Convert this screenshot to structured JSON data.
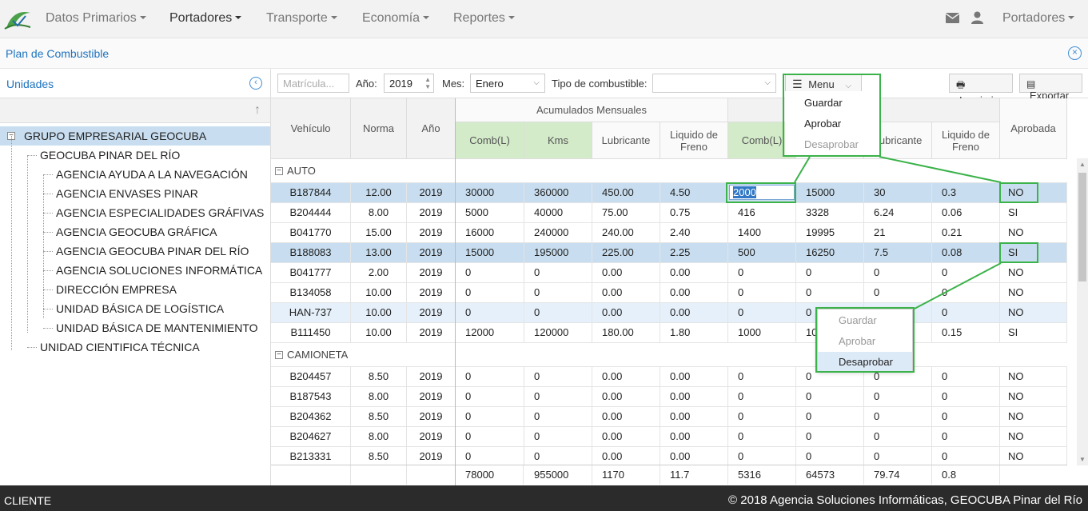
{
  "nav": {
    "items": [
      "Datos Primarios",
      "Portadores",
      "Transporte",
      "Economía",
      "Reportes"
    ],
    "right_label": "Portadores",
    "icons": [
      "envelope-icon",
      "user-icon"
    ]
  },
  "titlebar": {
    "title": "Plan de Combustible"
  },
  "left": {
    "header": "Unidades",
    "tree": [
      {
        "label": "GRUPO EMPRESARIAL GEOCUBA",
        "level": 0,
        "selected": true
      },
      {
        "label": "GEOCUBA PINAR DEL RÍO",
        "level": 1
      },
      {
        "label": "AGENCIA AYUDA A LA NAVEGACIÓN",
        "level": 2
      },
      {
        "label": "AGENCIA ENVASES PINAR",
        "level": 2
      },
      {
        "label": "AGENCIA ESPECIALIDADES GRÁFIVAS",
        "level": 2
      },
      {
        "label": "AGENCIA GEOCUBA GRÁFICA",
        "level": 2
      },
      {
        "label": "AGENCIA GEOCUBA PINAR DEL RÍO",
        "level": 2
      },
      {
        "label": "AGENCIA SOLUCIONES INFORMÁTICA",
        "level": 2
      },
      {
        "label": "DIRECCIÓN EMPRESA",
        "level": 2
      },
      {
        "label": "UNIDAD BÁSICA DE LOGÍSTICA",
        "level": 2
      },
      {
        "label": "UNIDAD BÁSICA DE MANTENIMIENTO",
        "level": 2
      },
      {
        "label": "UNIDAD CIENTIFICA TÉCNICA",
        "level": 1
      }
    ]
  },
  "toolbar": {
    "matricula_placeholder": "Matrícula...",
    "anio_label": "Año:",
    "anio_value": "2019",
    "mes_label": "Mes:",
    "mes_value": "Enero",
    "tipo_label": "Tipo de combustible:",
    "tipo_value": "",
    "menu_label": "Menu",
    "imprimir_label": "Imprimir",
    "exportar_label": "Exportar"
  },
  "grid": {
    "headers": {
      "vehiculo": "Vehículo",
      "norma": "Norma",
      "anio": "Año",
      "acumulados": "Acumulados Mensuales",
      "comb": "Comb(L)",
      "kms": "Kms",
      "lubricante": "Lubricante",
      "liquido": "Liquido de Freno",
      "comb2": "Comb(L)",
      "lubricante2": "Lubricante",
      "liquido2": "Liquido de Freno",
      "aprobada": "Aprobada"
    },
    "groups": [
      {
        "name": "AUTO",
        "rows": [
          [
            "B187844",
            "12.00",
            "2019",
            "30000",
            "360000",
            "450.00",
            "4.50",
            "2000",
            "15000",
            "30",
            "0.3",
            "NO"
          ],
          [
            "B204444",
            "8.00",
            "2019",
            "5000",
            "40000",
            "75.00",
            "0.75",
            "416",
            "3328",
            "6.24",
            "0.06",
            "SI"
          ],
          [
            "B041770",
            "15.00",
            "2019",
            "16000",
            "240000",
            "240.00",
            "2.40",
            "1400",
            "19995",
            "21",
            "0.21",
            "NO"
          ],
          [
            "B188083",
            "13.00",
            "2019",
            "15000",
            "195000",
            "225.00",
            "2.25",
            "500",
            "16250",
            "7.5",
            "0.08",
            "SI"
          ],
          [
            "B041777",
            "2.00",
            "2019",
            "0",
            "0",
            "0.00",
            "0.00",
            "0",
            "0",
            "0",
            "0",
            "NO"
          ],
          [
            "B134058",
            "10.00",
            "2019",
            "0",
            "0",
            "0.00",
            "0.00",
            "0",
            "0",
            "0",
            "0",
            "NO"
          ],
          [
            "HAN-737",
            "10.00",
            "2019",
            "0",
            "0",
            "0.00",
            "0.00",
            "0",
            "0",
            "0",
            "0",
            "NO"
          ],
          [
            "B111450",
            "10.00",
            "2019",
            "12000",
            "120000",
            "180.00",
            "1.80",
            "1000",
            "10",
            "",
            "0.15",
            "SI"
          ]
        ]
      },
      {
        "name": "CAMIONETA",
        "rows": [
          [
            "B204457",
            "8.50",
            "2019",
            "0",
            "0",
            "0.00",
            "0.00",
            "0",
            "0",
            "0",
            "0",
            "NO"
          ],
          [
            "B187543",
            "8.00",
            "2019",
            "0",
            "0",
            "0.00",
            "0.00",
            "0",
            "0",
            "0",
            "0",
            "NO"
          ],
          [
            "B204362",
            "8.50",
            "2019",
            "0",
            "0",
            "0.00",
            "0.00",
            "0",
            "0",
            "0",
            "0",
            "NO"
          ],
          [
            "B204627",
            "8.00",
            "2019",
            "0",
            "0",
            "0.00",
            "0.00",
            "0",
            "0",
            "0",
            "0",
            "NO"
          ],
          [
            "B213331",
            "8.50",
            "2019",
            "0",
            "0",
            "0.00",
            "0.00",
            "0",
            "0",
            "0",
            "0",
            "NO"
          ]
        ]
      }
    ],
    "totals": [
      "78000",
      "955000",
      "1170",
      "11.7",
      "5316",
      "64573",
      "79.74",
      "0.8"
    ]
  },
  "menu_top": {
    "items": [
      "Guardar",
      "Aprobar",
      "Desaprobar"
    ]
  },
  "menu_context": {
    "items": [
      "Guardar",
      "Aprobar",
      "Desaprobar"
    ]
  },
  "footer": {
    "left": "CLIENTE",
    "right": "© 2018 Agencia Soluciones Informáticas, GEOCUBA Pinar del Río"
  }
}
